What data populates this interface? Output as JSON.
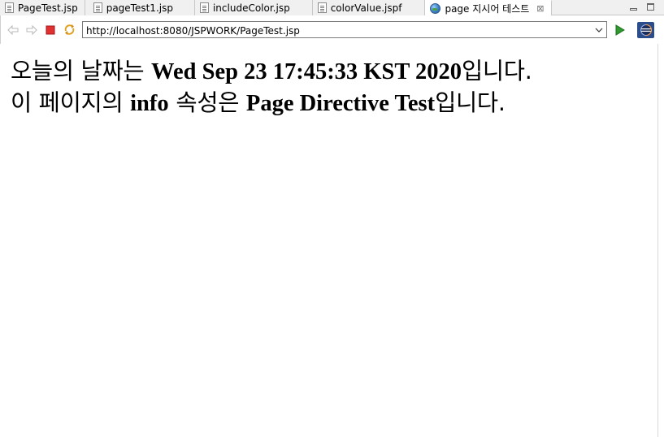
{
  "tabs": [
    {
      "label": "PageTest.jsp",
      "icon": "jsp-file-icon",
      "active": false
    },
    {
      "label": "pageTest1.jsp",
      "icon": "jsp-file-icon",
      "active": false
    },
    {
      "label": "includeColor.jsp",
      "icon": "jsp-file-icon",
      "active": false
    },
    {
      "label": "colorValue.jspf",
      "icon": "jspf-file-icon",
      "active": false
    },
    {
      "label": "page 지시어 테스트",
      "icon": "globe-icon",
      "active": true,
      "close": "⊠"
    }
  ],
  "toolbar": {
    "url": "http://localhost:8080/JSPWORK/PageTest.jsp",
    "back_icon": "back-arrow-icon",
    "forward_icon": "forward-arrow-icon",
    "stop_icon": "stop-icon",
    "refresh_icon": "refresh-icon",
    "go_icon": "go-play-icon",
    "eclipse_icon": "eclipse-icon"
  },
  "content": {
    "line1": {
      "prefix": "오늘의 날짜는 ",
      "value": "Wed Sep 23 17:45:33 KST 2020",
      "suffix": "입니다."
    },
    "line2": {
      "prefix": "이 페이지의 ",
      "value": "info",
      "middle": " 속성은 ",
      "value2": "Page Directive Test",
      "suffix": "입니다."
    }
  },
  "colors": {
    "stop": "#e03030",
    "go": "#2f9a2f",
    "eclipse_bg": "#2b4d8c"
  }
}
